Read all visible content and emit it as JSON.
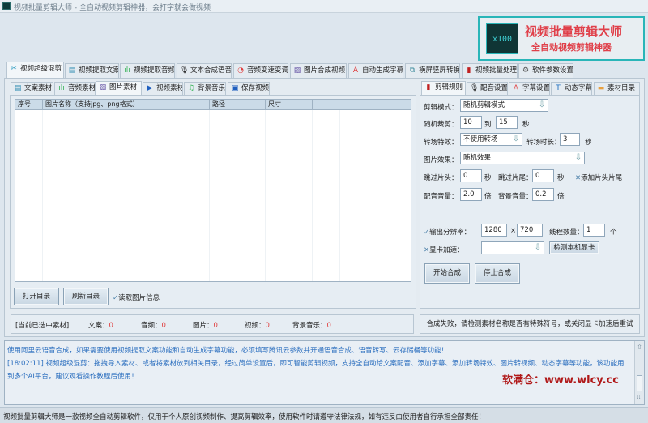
{
  "window": {
    "title": "视频批量剪辑大师 - 全自动视频剪辑神器，会打字就会做视频"
  },
  "logo": {
    "badge": "x100",
    "line1": "视频批量剪辑大师",
    "line2": "全自动视频剪辑神器"
  },
  "main_tabs": [
    {
      "label": "视频超级混剪",
      "icon": "scissors-icon"
    },
    {
      "label": "视频提取文案",
      "icon": "document-icon"
    },
    {
      "label": "视频提取音频",
      "icon": "audio-wave-icon"
    },
    {
      "label": "文本合成语音",
      "icon": "microphone-icon"
    },
    {
      "label": "音频变速变调",
      "icon": "speedometer-icon"
    },
    {
      "label": "图片合成视频",
      "icon": "image-icon"
    },
    {
      "label": "自动生成字幕",
      "icon": "font-icon"
    },
    {
      "label": "横屏竖屏转换",
      "icon": "rotate-icon"
    },
    {
      "label": "视频批量处理",
      "icon": "film-icon"
    },
    {
      "label": "软件参数设置",
      "icon": "gear-icon"
    }
  ],
  "left_tabs": [
    {
      "label": "文案素材",
      "icon": "document-icon"
    },
    {
      "label": "音频素材",
      "icon": "audio-wave-icon"
    },
    {
      "label": "图片素材",
      "icon": "image-icon"
    },
    {
      "label": "视频素材",
      "icon": "play-icon"
    },
    {
      "label": "背景音乐",
      "icon": "music-icon"
    },
    {
      "label": "保存视频",
      "icon": "save-icon"
    }
  ],
  "table": {
    "columns": [
      "序号",
      "图片名称（支持jpg、png格式）",
      "路径",
      "尺寸",
      ""
    ],
    "rows": []
  },
  "left_buttons": {
    "open": "打开目录",
    "refresh": "刷新目录",
    "read_info": "读取图片信息"
  },
  "selected": {
    "label": "[当前已选中素材]",
    "items": [
      {
        "label": "文案：",
        "value": "0"
      },
      {
        "label": "音频：",
        "value": "0"
      },
      {
        "label": "图片：",
        "value": "0"
      },
      {
        "label": "视频：",
        "value": "0"
      },
      {
        "label": "背景音乐：",
        "value": "0"
      }
    ]
  },
  "right_tabs": [
    {
      "label": "剪辑规则",
      "icon": "film-icon"
    },
    {
      "label": "配音设置",
      "icon": "microphone-icon"
    },
    {
      "label": "字幕设置",
      "icon": "font-icon"
    },
    {
      "label": "动态字幕",
      "icon": "text-box-icon"
    },
    {
      "label": "素材目录",
      "icon": "folder-icon"
    }
  ],
  "form": {
    "mode_label": "剪辑模式：",
    "mode_value": "随机剪辑模式",
    "cut_label": "随机裁剪：",
    "cut_from": "10",
    "cut_to_label": "到",
    "cut_to": "15",
    "sec": "秒",
    "transition_label": "转场特效：",
    "transition_value": "不使用转场",
    "trans_dur_label": "转场时长：",
    "trans_dur": "3",
    "effect_label": "图片效果：",
    "effect_value": "随机效果",
    "skip_head_label": "跳过片头：",
    "skip_head": "0",
    "skip_tail_label": "跳过片尾：",
    "skip_tail": "0",
    "add_head_tail": "添加片头片尾",
    "voice_vol_label": "配音音量：",
    "voice_vol": "2.0",
    "times": "倍",
    "bg_vol_label": "背景音量：",
    "bg_vol": "0.2",
    "res_label": "输出分辨率：",
    "res_w": "1280",
    "res_x": "×",
    "res_h": "720",
    "threads_label": "线程数量：",
    "threads": "1",
    "unit": "个",
    "gpu_label": "显卡加速：",
    "gpu_value": "",
    "detect_gpu": "检测本机显卡",
    "start": "开始合成",
    "stop": "停止合成"
  },
  "right_status": "合成失败，请检测素材名称是否有特殊符号，或关闭显卡加速后重试",
  "log": [
    "使用阿里云语音合成，如果需要使用视频提取文案功能和自动生成字幕功能，必须填写腾讯云参数并开通语音合成、语音转写、云存储桶等功能！",
    "[18:02:11] 视频超级混剪：拖拽导入素材、或者将素材放到相关目录，经过简单设置后，即可智能剪辑视频，支持全自动给文案配音、添加字幕、添加转场特效、图片转视频、动态字幕等功能，该功能用到多个AI平台，建议观看操作教程后使用！"
  ],
  "watermark": "软满仓：www.wlcy.cc",
  "footer": "视频批量剪辑大师是一款视频全自动剪辑软件，仅用于个人原创视频制作、提高剪辑效率，使用软件时请遵守法律法规，如有违反由使用者自行承担全部责任！"
}
